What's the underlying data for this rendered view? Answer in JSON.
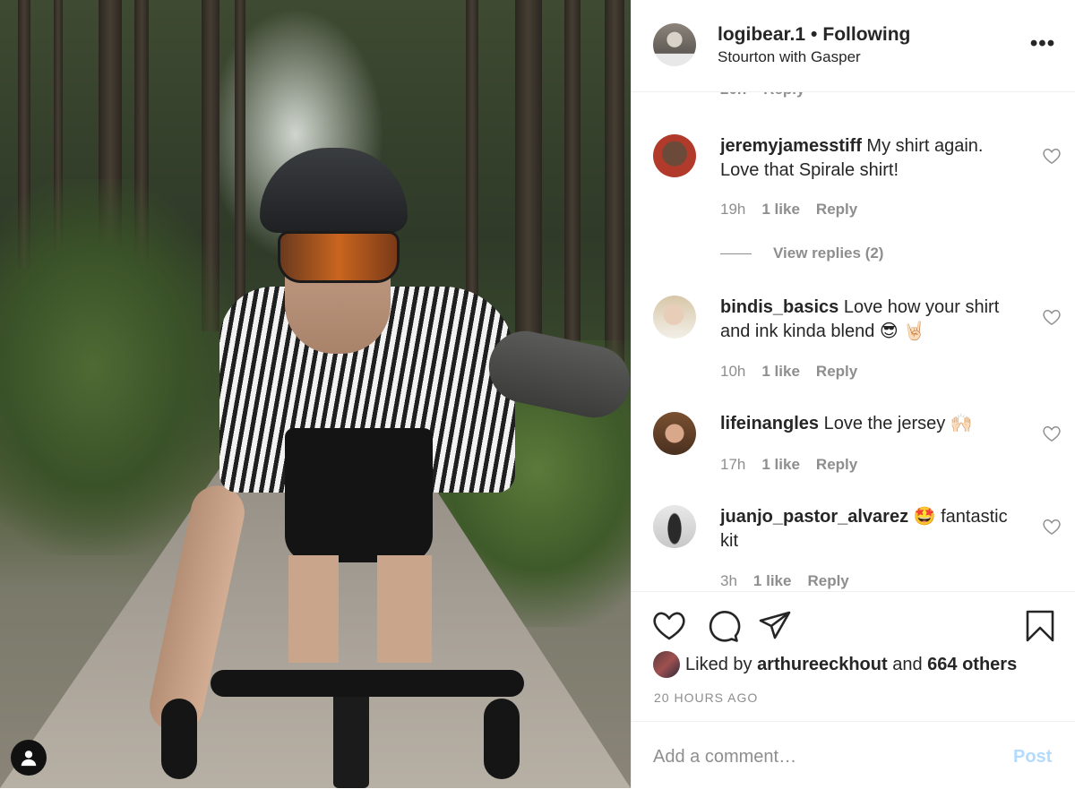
{
  "post": {
    "username": "logibear.1",
    "separator": "•",
    "follow_status": "Following",
    "location": "Stourton with Gasper",
    "more_icon": "more-horizontal-icon",
    "more_label": "•••"
  },
  "comments_partial": {
    "text": "20h    Reply"
  },
  "comments": [
    {
      "username": "jeremyjamesstiff",
      "text": " My shirt again. Love that Spirale shirt!",
      "time": "19h",
      "likes": "1 like",
      "reply": "Reply",
      "view_replies": "View replies (2)"
    },
    {
      "username": "bindis_basics",
      "text": " Love how your shirt and ink kinda blend 😎 🤘🏻",
      "time": "10h",
      "likes": "1 like",
      "reply": "Reply"
    },
    {
      "username": "lifeinangles",
      "text": " Love the jersey 🙌🏻",
      "time": "17h",
      "likes": "1 like",
      "reply": "Reply"
    },
    {
      "username": "juanjo_pastor_alvarez",
      "text": " 🤩  fantastic kit",
      "time": "3h",
      "likes": "1 like",
      "reply": "Reply"
    }
  ],
  "actions": {
    "like_icon": "heart-icon",
    "comment_icon": "comment-icon",
    "share_icon": "share-icon",
    "save_icon": "bookmark-icon",
    "liked_by_prefix": "Liked by ",
    "liked_by_user": "arthureeckhout",
    "liked_by_mid": " and ",
    "liked_by_others": "664 others",
    "timestamp": "20 HOURS AGO"
  },
  "add_comment": {
    "placeholder": "Add a comment…",
    "post_label": "Post"
  },
  "colors": {
    "text": "#262626",
    "muted": "#8e8e8e",
    "post_disabled": "#b3dbff",
    "divider": "#efefef"
  }
}
